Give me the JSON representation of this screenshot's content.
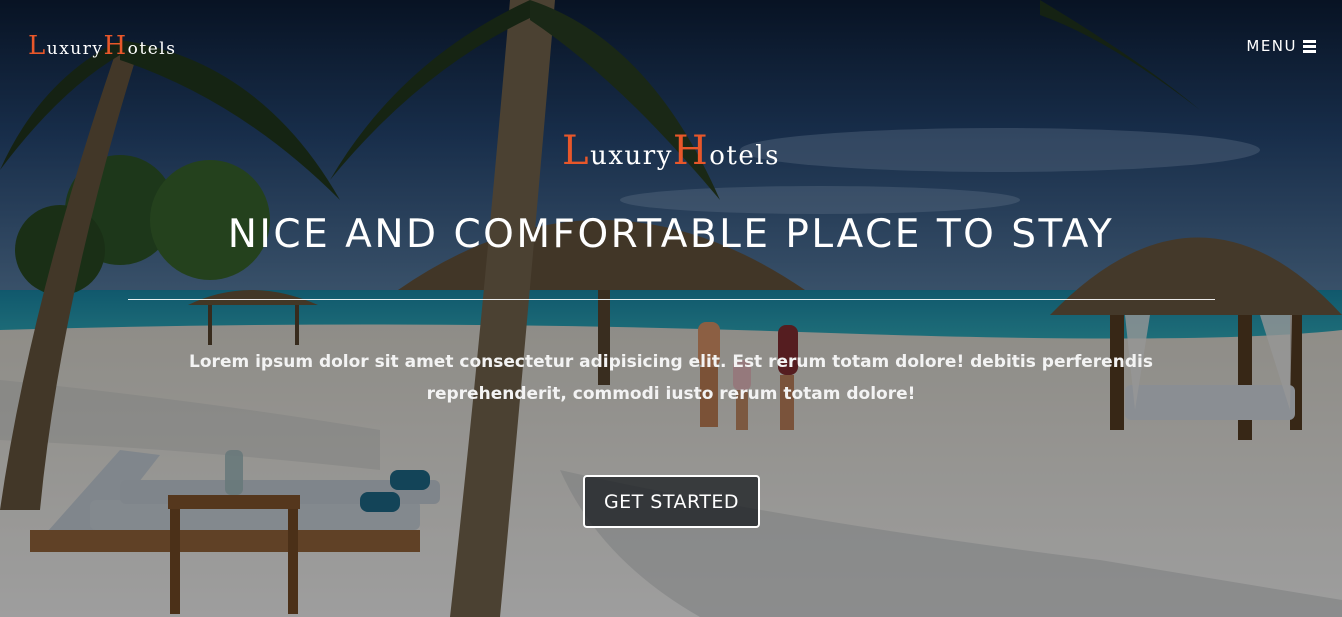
{
  "colors": {
    "accent": "#e8572a",
    "text": "#ffffff",
    "overlay": "rgba(0,0,0,0.38)"
  },
  "navbar": {
    "brand": {
      "first_initial": "L",
      "first_rest": "uxury",
      "second_initial": "H",
      "second_rest": "otels"
    },
    "menu": {
      "label": "MENU",
      "icon": "hamburger-icon"
    }
  },
  "hero": {
    "brand": {
      "first_initial": "L",
      "first_rest": "uxury",
      "second_initial": "H",
      "second_rest": "otels"
    },
    "headline": "NICE AND COMFORTABLE PLACE TO STAY",
    "lead": "Lorem ipsum dolor sit amet consectetur adipisicing elit. Est rerum totam dolore! debitis perferendis reprehenderit, commodi iusto rerum totam dolore!",
    "cta_label": "GET STARTED",
    "background_image": "tropical-beach-with-palm-trees-and-cabanas"
  }
}
